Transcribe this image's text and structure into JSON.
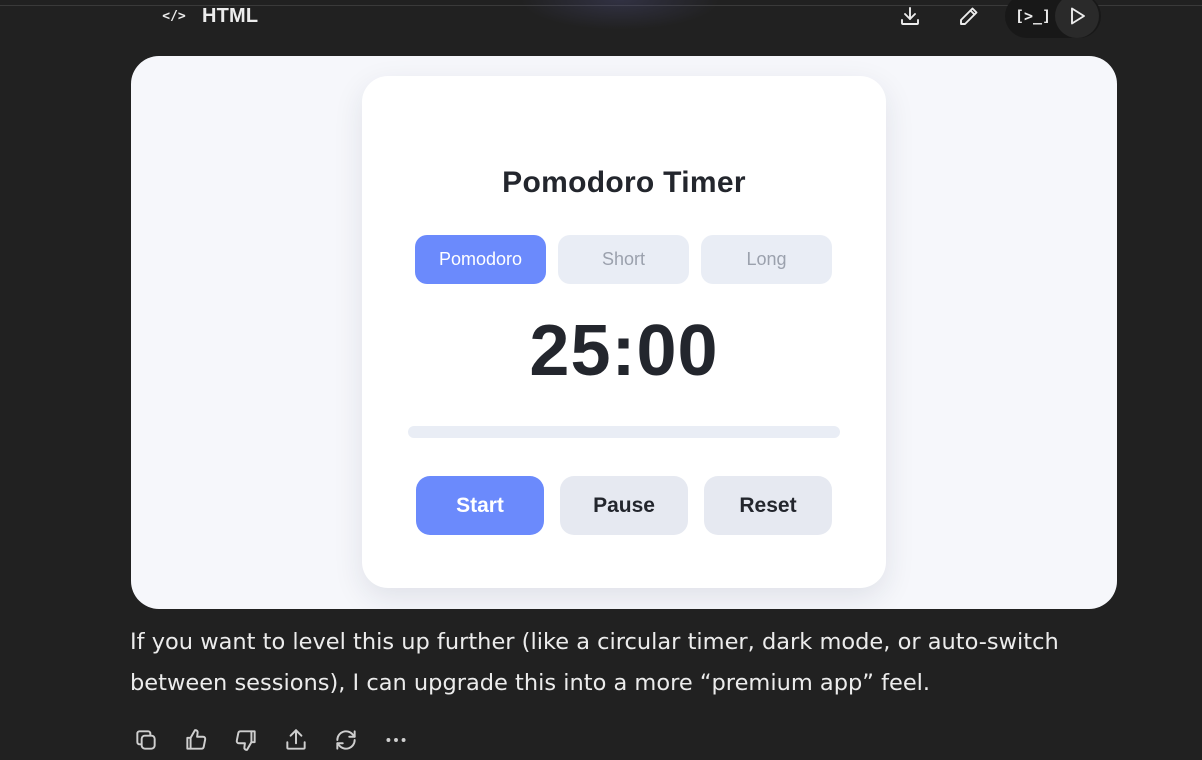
{
  "code_block": {
    "language_label": "HTML",
    "icons": {
      "code": "code-icon",
      "download": "download-icon",
      "edit": "pencil-icon",
      "console": "console-icon",
      "run": "play-icon"
    },
    "code_icon_glyph": "</>",
    "console_glyph": "[>_]"
  },
  "app": {
    "title": "Pomodoro Timer",
    "modes": [
      {
        "label": "Pomodoro",
        "active": true
      },
      {
        "label": "Short",
        "active": false
      },
      {
        "label": "Long",
        "active": false
      }
    ],
    "time": "25:00",
    "progress": 0,
    "controls": {
      "start": "Start",
      "pause": "Pause",
      "reset": "Reset"
    },
    "colors": {
      "accent": "#6b8afc",
      "card": "#ffffff",
      "surface": "#f6f7fb",
      "muted": "#e9edf5",
      "text": "#23262d"
    }
  },
  "message": {
    "text": "If you want to level this up further (like a circular timer, dark mode, or auto-switch between sessions), I can upgrade this into a more “premium app” feel."
  },
  "message_actions": [
    "copy-icon",
    "thumbs-up-icon",
    "thumbs-down-icon",
    "share-icon",
    "regenerate-icon",
    "more-icon"
  ]
}
